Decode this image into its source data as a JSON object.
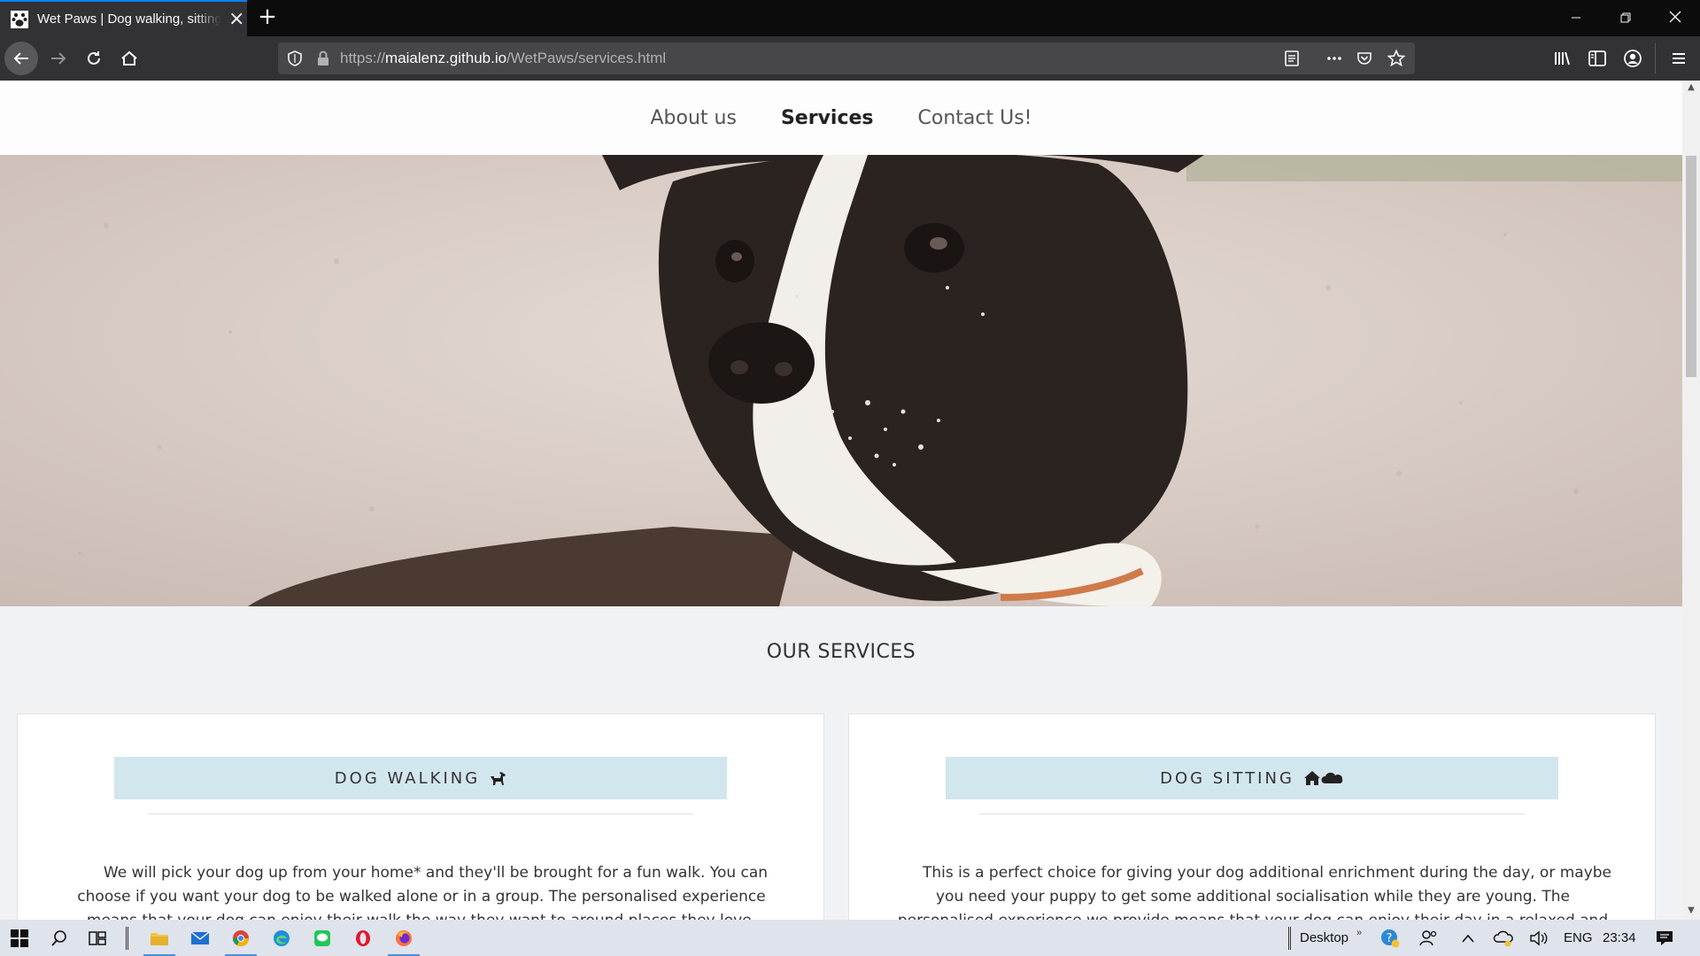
{
  "browser": {
    "tab_title": "Wet Paws | Dog walking, sitting & more",
    "url_scheme": "https://",
    "url_host": "maialenz.github.io",
    "url_path": "/WetPaws/services.html"
  },
  "site": {
    "nav": [
      {
        "label": "About us",
        "active": false
      },
      {
        "label": "Services",
        "active": true
      },
      {
        "label": "Contact Us!",
        "active": false
      }
    ],
    "section_title": "OUR SERVICES",
    "cards": [
      {
        "title": "DOG WALKING",
        "icon": "dog-icon",
        "text": "We will pick your dog up from your home* and they'll be brought for a fun walk. You can choose if you want your dog to be walked alone or in a group. The personalised experience means that your dog can enjoy their walk the way they want to around places they love."
      },
      {
        "title": "DOG SITTING",
        "icon": "house-and-cloud-icon",
        "text": "This is a perfect choice for giving your dog additional enrichment during the day, or maybe you need your puppy to get some additional socialisation while they are young. The personalised experience we provide means that your dog can enjoy their day in a relaxed and"
      }
    ]
  },
  "taskbar": {
    "desktop_label": "Desktop",
    "lang": "ENG",
    "time": "23:34"
  },
  "colors": {
    "card_header_bg": "#d2e6ed",
    "page_bg": "#f1f2f4",
    "browser_chrome": "#323234",
    "tab_accent": "#0a84ff"
  }
}
